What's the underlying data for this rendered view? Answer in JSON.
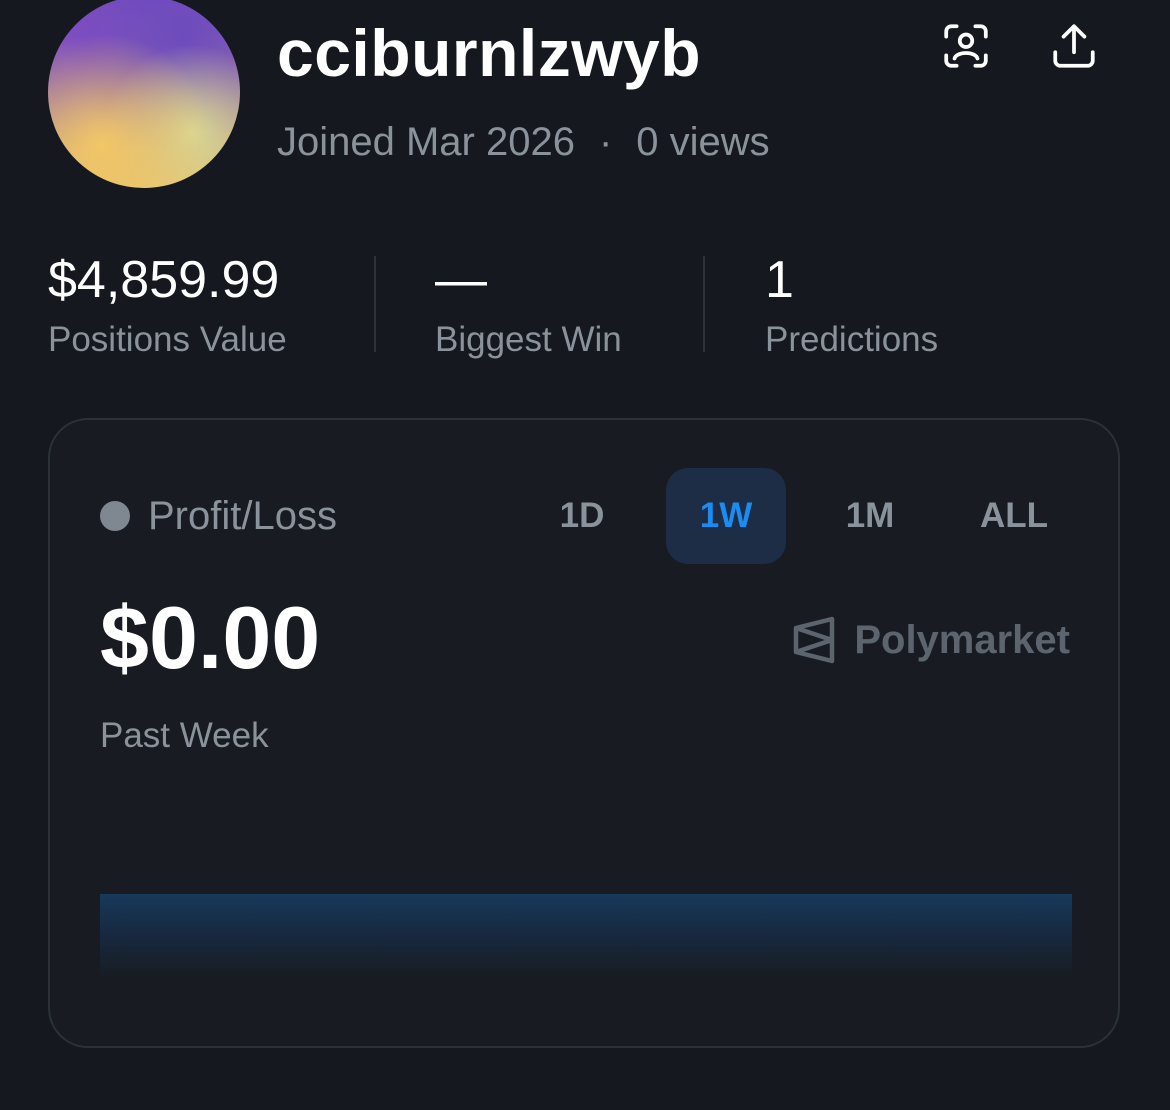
{
  "profile": {
    "username": "cciburnlzwyb",
    "joined": "Joined Mar 2026",
    "separator": "·",
    "views": "0 views",
    "scan_icon": "scan-user-icon",
    "share_icon": "share-upload-icon"
  },
  "stats": [
    {
      "value": "$4,859.99",
      "label": "Positions Value"
    },
    {
      "value": "—",
      "label": "Biggest Win"
    },
    {
      "value": "1",
      "label": "Predictions"
    }
  ],
  "pl_card": {
    "title": "Profit/Loss",
    "tabs": [
      "1D",
      "1W",
      "1M",
      "ALL"
    ],
    "active_tab": "1W",
    "value": "$0.00",
    "period": "Past Week",
    "brand": "Polymarket",
    "accent_color": "#1b8cf2",
    "chart_fill_color": "#17395a"
  }
}
